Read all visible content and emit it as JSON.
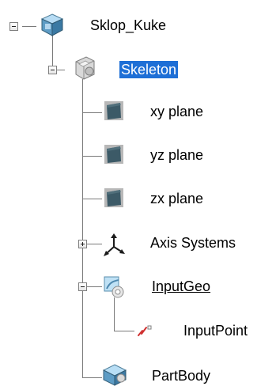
{
  "tree": {
    "root": {
      "label": "Sklop_Kuke"
    },
    "skeleton": {
      "label": "Skeleton"
    },
    "children": {
      "xy_plane": "xy plane",
      "yz_plane": "yz plane",
      "zx_plane": "zx plane",
      "axis_systems": "Axis Systems",
      "input_geo": "InputGeo",
      "input_point": "InputPoint",
      "part_body": "PartBody"
    }
  },
  "colors": {
    "selection": "#1e6fd6",
    "plane_face": "#3c5a67",
    "tree_line": "#7a7a7a"
  }
}
